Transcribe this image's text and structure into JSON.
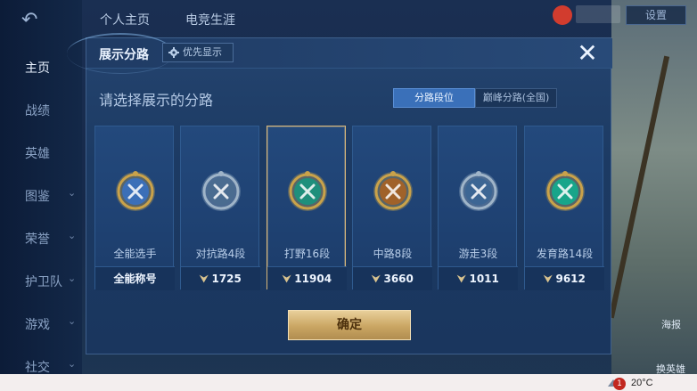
{
  "background": {
    "tabs": [
      "个人主页",
      "电竞生涯"
    ],
    "settings_label": "设置",
    "sidebar": [
      {
        "label": "主页",
        "active": true,
        "chevron": false
      },
      {
        "label": "战绩",
        "active": false,
        "chevron": false
      },
      {
        "label": "英雄",
        "active": false,
        "chevron": false
      },
      {
        "label": "图鉴",
        "active": false,
        "chevron": true
      },
      {
        "label": "荣誉",
        "active": false,
        "chevron": true
      },
      {
        "label": "护卫队",
        "active": false,
        "chevron": true
      },
      {
        "label": "游戏",
        "active": false,
        "chevron": true
      },
      {
        "label": "社交",
        "active": false,
        "chevron": true
      }
    ],
    "right_labels": [
      "海报",
      "换英雄"
    ]
  },
  "modal": {
    "title": "展示分路",
    "priority_button": "优先显示",
    "close_icon": "close-icon",
    "subtitle": "请选择展示的分路",
    "segments": [
      {
        "label": "分路段位",
        "active": true
      },
      {
        "label": "巅峰分路(全国)",
        "active": false
      }
    ],
    "cards": [
      {
        "name": "全能选手",
        "foot": "全能称号",
        "has_mark": false,
        "selected": false,
        "badge_color": "#c9a24a",
        "inner_color": "#3b6fb8",
        "icon": "allround-icon"
      },
      {
        "name": "对抗路4段",
        "foot": "1725",
        "has_mark": true,
        "selected": false,
        "badge_color": "#9fb4c8",
        "inner_color": "#4a6c90",
        "icon": "clash-lane-icon"
      },
      {
        "name": "打野16段",
        "foot": "11904",
        "has_mark": true,
        "selected": true,
        "badge_color": "#c9a24a",
        "inner_color": "#1f8f7c",
        "icon": "jungle-icon"
      },
      {
        "name": "中路8段",
        "foot": "3660",
        "has_mark": true,
        "selected": false,
        "badge_color": "#c9a24a",
        "inner_color": "#a0622a",
        "icon": "mid-lane-icon"
      },
      {
        "name": "游走3段",
        "foot": "1011",
        "has_mark": true,
        "selected": false,
        "badge_color": "#9fb4c8",
        "inner_color": "#3c6694",
        "icon": "roam-icon"
      },
      {
        "name": "发育路14段",
        "foot": "9612",
        "has_mark": true,
        "selected": false,
        "badge_color": "#c9a24a",
        "inner_color": "#18a58a",
        "icon": "farm-lane-icon"
      }
    ],
    "confirm_label": "确定"
  },
  "taskbar": {
    "notification_count": "1",
    "temperature": "20°C"
  }
}
